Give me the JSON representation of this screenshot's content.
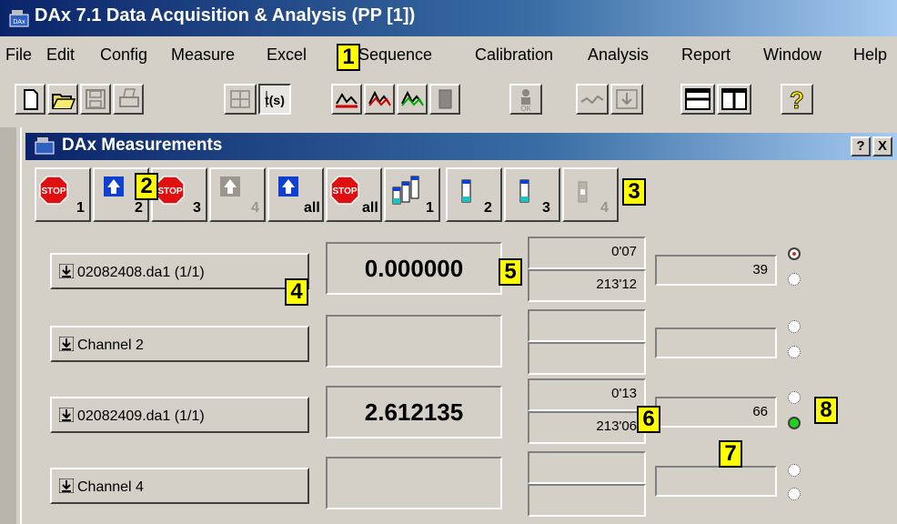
{
  "window": {
    "title": "DAx 7.1 Data Acquisition & Analysis (PP [1])"
  },
  "menu": [
    "File",
    "Edit",
    "Config",
    "Measure",
    "Excel",
    "Sequence",
    "Calibration",
    "Analysis",
    "Report",
    "Window",
    "Help"
  ],
  "toolbar": {
    "icons": [
      "new-icon",
      "open-icon",
      "save-icon",
      "print-icon",
      "move-icon",
      "timer-icon",
      "chart-red-icon",
      "chart-multi-icon",
      "chart-green-icon",
      "device-icon",
      "ok-person-icon",
      "curve-icon",
      "import-icon",
      "layout-horizontal-icon",
      "layout-vertical-icon",
      "help-icon"
    ]
  },
  "child_window": {
    "title": "DAx Measurements",
    "help_label": "?",
    "close_label": "X"
  },
  "measure_buttons": [
    {
      "icon": "stop-icon",
      "sub": "1"
    },
    {
      "icon": "upload-icon",
      "sub": "2"
    },
    {
      "icon": "stop-icon",
      "sub": "3"
    },
    {
      "icon": "upload-icon",
      "sub": "4"
    },
    {
      "icon": "upload-icon",
      "sub": "all"
    },
    {
      "icon": "stop-icon",
      "sub": "all"
    },
    {
      "icon": "vials-icon",
      "sub": "1"
    },
    {
      "icon": "vial-icon",
      "sub": "2"
    },
    {
      "icon": "vial-icon",
      "sub": "3"
    },
    {
      "icon": "vial-icon",
      "sub": "4"
    }
  ],
  "channels": [
    {
      "label": "02082408.da1 (1/1)",
      "value": "0.000000",
      "time_top": "0'07",
      "time_bottom": "213'12",
      "count": "39",
      "led_top": "red",
      "led_bottom": "off"
    },
    {
      "label": "Channel 2",
      "value": "",
      "time_top": "",
      "time_bottom": "",
      "count": "",
      "led_top": "off",
      "led_bottom": "off"
    },
    {
      "label": "02082409.da1 (1/1)",
      "value": "2.612135",
      "time_top": "0'13",
      "time_bottom": "213'06",
      "count": "66",
      "led_top": "off",
      "led_bottom": "green"
    },
    {
      "label": "Channel 4",
      "value": "",
      "time_top": "",
      "time_bottom": "",
      "count": "",
      "led_top": "off",
      "led_bottom": "off"
    }
  ],
  "callouts": [
    "1",
    "2",
    "3",
    "4",
    "5",
    "6",
    "7",
    "8"
  ],
  "colors": {
    "title_dark": "#0a246a",
    "title_light": "#a6caf0",
    "face": "#d4d0c8",
    "callout": "#ffff00"
  }
}
